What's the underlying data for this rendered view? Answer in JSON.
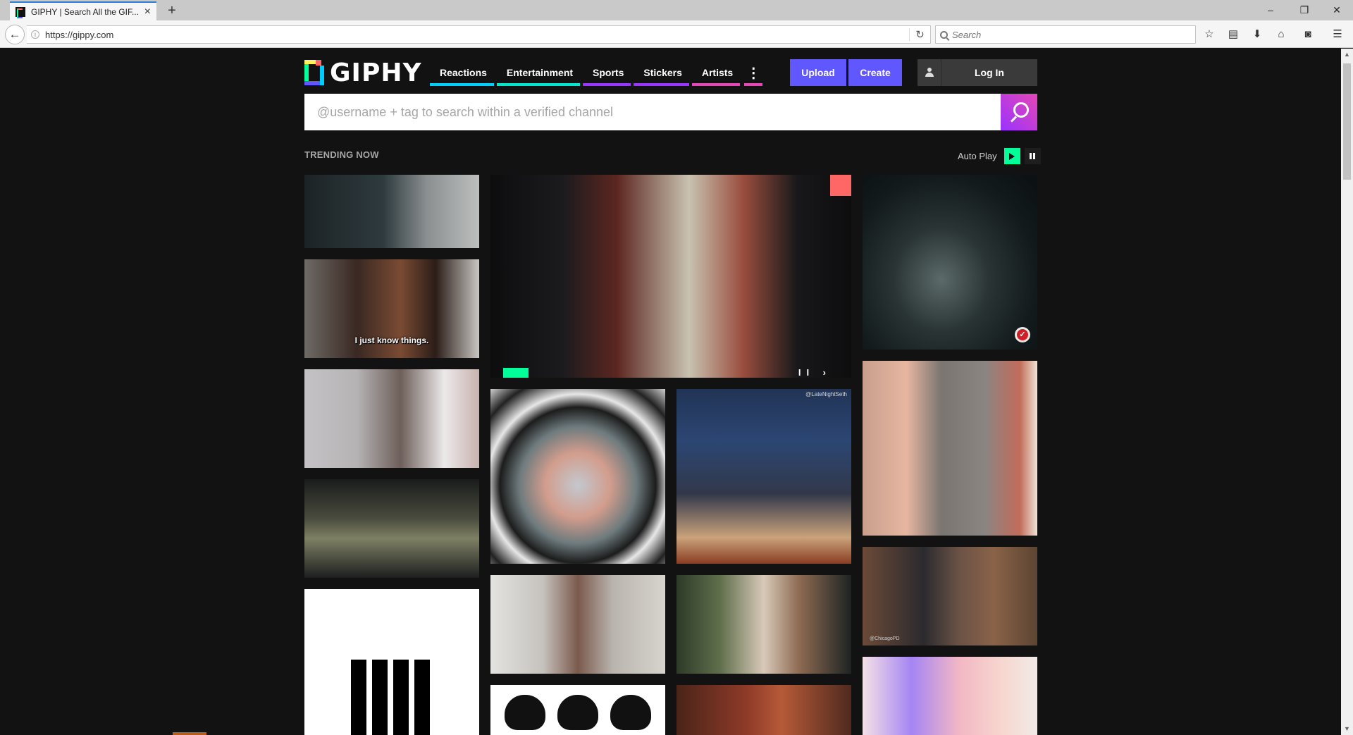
{
  "browser": {
    "tab_title": "GIPHY | Search All the GIF...",
    "tab_close": "×",
    "new_tab": "+",
    "url": "https://gippy.com",
    "search_placeholder": "Search",
    "window_controls": [
      "–",
      "❐",
      "✕"
    ],
    "toolbar_icons": [
      "star-icon",
      "clipboard-icon",
      "download-icon",
      "home-icon",
      "pocket-icon",
      "menu-icon"
    ]
  },
  "site": {
    "logo_text": "GIPHY",
    "nav": [
      {
        "label": "Reactions",
        "color": "#00ccff"
      },
      {
        "label": "Entertainment",
        "color": "#00e6cc"
      },
      {
        "label": "Sports",
        "color": "#9933ff"
      },
      {
        "label": "Stickers",
        "color": "#9933ff"
      },
      {
        "label": "Artists",
        "color": "#e646b6"
      }
    ],
    "upload_label": "Upload",
    "create_label": "Create",
    "login_label": "Log In",
    "search_placeholder": "@username + tag to search within a verified channel",
    "trending_label": "TRENDING NOW",
    "autoplay_label": "Auto Play"
  },
  "gifs": [
    {
      "id": "g1",
      "caption": ""
    },
    {
      "id": "g2",
      "caption": "I just know things."
    },
    {
      "id": "g3",
      "caption": ""
    },
    {
      "id": "g4",
      "caption": ""
    },
    {
      "id": "g5",
      "caption": ""
    },
    {
      "id": "g6",
      "caption": "",
      "controls": "II ›"
    },
    {
      "id": "g7",
      "caption": "",
      "badge": "✓"
    },
    {
      "id": "g8",
      "caption": ""
    },
    {
      "id": "g9",
      "caption": ""
    },
    {
      "id": "g10",
      "caption": "",
      "watermark": "@LateNightSeth"
    },
    {
      "id": "g11",
      "caption": ""
    },
    {
      "id": "g12",
      "caption": ""
    },
    {
      "id": "g13",
      "caption": "",
      "watermark": "@ChicagoPD"
    },
    {
      "id": "g14",
      "caption": ""
    },
    {
      "id": "g15",
      "caption": ""
    },
    {
      "id": "g16",
      "caption": ""
    }
  ],
  "colors": {
    "brand_purple": "#6157ff",
    "brand_green": "#00ff99",
    "brand_red": "#ff6666",
    "page_bg": "#121212"
  }
}
